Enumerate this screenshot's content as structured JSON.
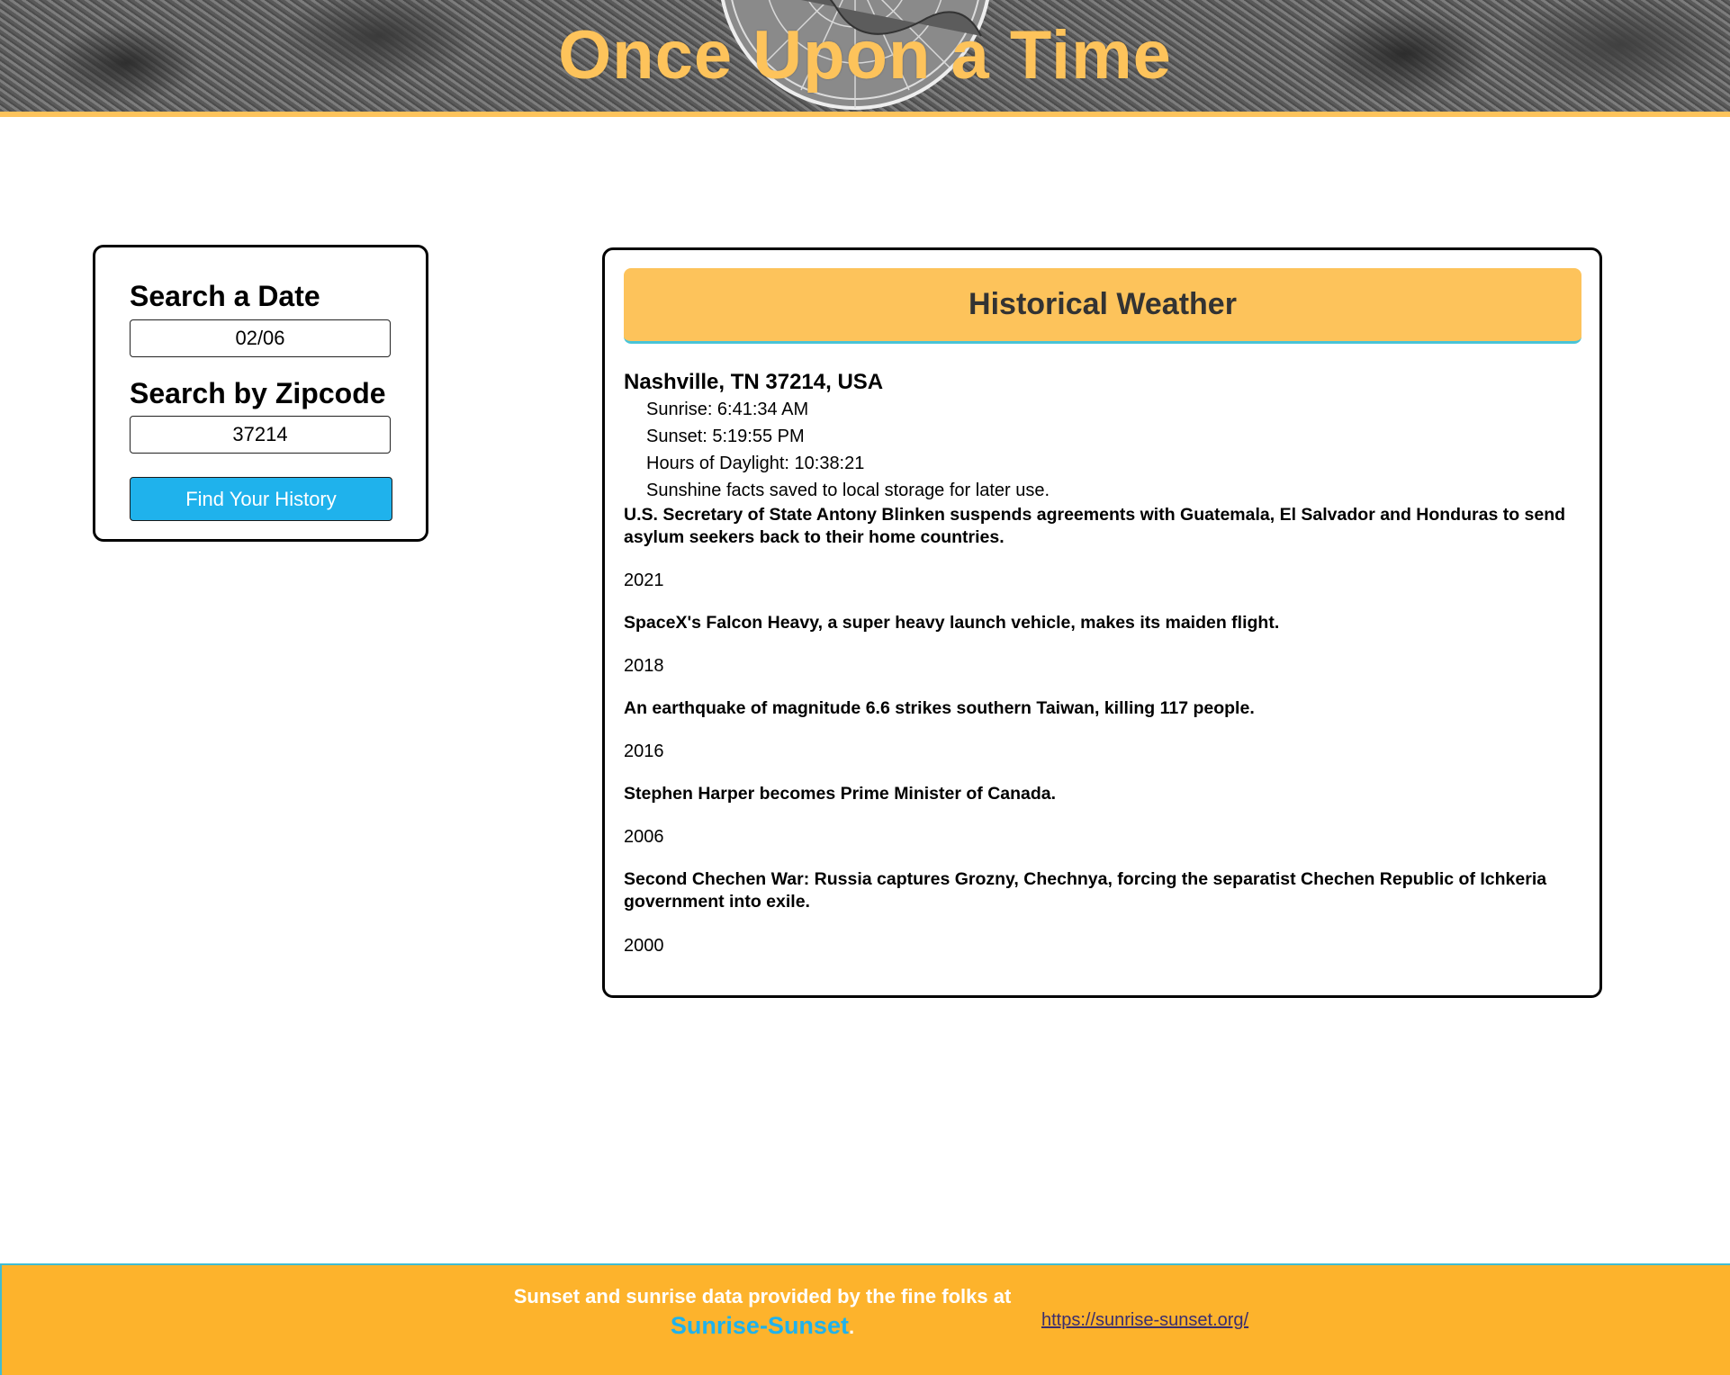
{
  "header": {
    "title": "Once Upon a Time"
  },
  "search": {
    "date_label": "Search a Date",
    "date_value": "02/06",
    "zip_label": "Search by Zipcode",
    "zip_value": "37214",
    "button_label": "Find Your History"
  },
  "results": {
    "banner_title": "Historical Weather",
    "location": "Nashville, TN 37214, USA",
    "sun_lines": [
      "Sunrise: 6:41:34 AM",
      "Sunset: 5:19:55 PM",
      "Hours of Daylight: 10:38:21",
      "Sunshine facts saved to local storage for later use."
    ],
    "events": [
      {
        "text": "U.S. Secretary of State Antony Blinken suspends agreements with Guatemala, El Salvador and Honduras to send asylum seekers back to their home countries.",
        "year": "2021"
      },
      {
        "text": "SpaceX's Falcon Heavy, a super heavy launch vehicle, makes its maiden flight.",
        "year": "2018"
      },
      {
        "text": "An earthquake of magnitude 6.6 strikes southern Taiwan, killing 117 people.",
        "year": "2016"
      },
      {
        "text": "Stephen Harper becomes Prime Minister of Canada.",
        "year": "2006"
      },
      {
        "text": "Second Chechen War: Russia captures Grozny, Chechnya, forcing the separatist Chechen Republic of Ichkeria government into exile.",
        "year": "2000"
      }
    ]
  },
  "footer": {
    "text_before": "Sunset and sunrise data provided by the fine folks at",
    "brand": "Sunrise-Sunset",
    "text_after": ".",
    "link_text": "https://sunrise-sunset.org/"
  },
  "colors": {
    "accent_gold": "#fdc35b",
    "footer_orange": "#fdb32c",
    "button_blue": "#1fb2ec",
    "banner_underline": "#48c4d8"
  }
}
